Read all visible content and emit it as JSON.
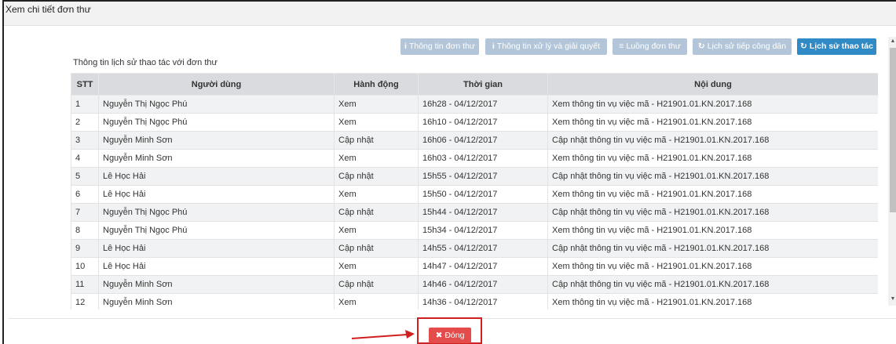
{
  "modal": {
    "title": "Xem chi tiết đơn thư"
  },
  "tabs": [
    {
      "icon": "i",
      "label": "Thông tin đơn thư"
    },
    {
      "icon": "i",
      "label": "Thông tin xử lý và giải quyết"
    },
    {
      "icon": "≡",
      "label": "Luồng đơn thư"
    },
    {
      "icon": "↻",
      "label": "Lịch sử tiếp công dân"
    },
    {
      "icon": "↻",
      "label": "Lịch sử thao tác"
    }
  ],
  "section": {
    "title": "Thông tin lịch sử thao tác với đơn thư"
  },
  "table": {
    "headers": [
      "STT",
      "Người dùng",
      "Hành động",
      "Thời gian",
      "Nội dung"
    ],
    "rows": [
      [
        "1",
        "Nguyễn Thị Ngọc Phú",
        "Xem",
        "16h28 - 04/12/2017",
        "Xem thông tin vụ việc mã - H21901.01.KN.2017.168"
      ],
      [
        "2",
        "Nguyễn Thị Ngọc Phú",
        "Xem",
        "16h10 - 04/12/2017",
        "Xem thông tin vụ việc mã - H21901.01.KN.2017.168"
      ],
      [
        "3",
        "Nguyễn Minh Sơn",
        "Cập nhật",
        "16h06 - 04/12/2017",
        "Cập nhật thông tin vụ việc mã - H21901.01.KN.2017.168"
      ],
      [
        "4",
        "Nguyễn Minh Sơn",
        "Xem",
        "16h03 - 04/12/2017",
        "Xem thông tin vụ việc mã - H21901.01.KN.2017.168"
      ],
      [
        "5",
        "Lê Học Hải",
        "Cập nhật",
        "15h55 - 04/12/2017",
        "Cập nhật thông tin vụ việc mã - H21901.01.KN.2017.168"
      ],
      [
        "6",
        "Lê Học Hải",
        "Xem",
        "15h50 - 04/12/2017",
        "Xem thông tin vụ việc mã - H21901.01.KN.2017.168"
      ],
      [
        "7",
        "Nguyễn Thị Ngọc Phú",
        "Cập nhật",
        "15h44 - 04/12/2017",
        "Cập nhật thông tin vụ việc mã - H21901.01.KN.2017.168"
      ],
      [
        "8",
        "Nguyễn Thị Ngọc Phú",
        "Xem",
        "15h34 - 04/12/2017",
        "Xem thông tin vụ việc mã - H21901.01.KN.2017.168"
      ],
      [
        "9",
        "Lê Học Hải",
        "Cập nhật",
        "14h55 - 04/12/2017",
        "Cập nhật thông tin vụ việc mã - H21901.01.KN.2017.168"
      ],
      [
        "10",
        "Lê Học Hải",
        "Xem",
        "14h47 - 04/12/2017",
        "Xem thông tin vụ việc mã - H21901.01.KN.2017.168"
      ],
      [
        "11",
        "Nguyễn Minh Sơn",
        "Cập nhật",
        "14h46 - 04/12/2017",
        "Cập nhật thông tin vụ việc mã - H21901.01.KN.2017.168"
      ],
      [
        "12",
        "Nguyễn Minh Sơn",
        "Xem",
        "14h36 - 04/12/2017",
        "Xem thông tin vụ việc mã - H21901.01.KN.2017.168"
      ]
    ]
  },
  "footer": {
    "close_icon": "✖",
    "close_label": "Đóng"
  },
  "colors": {
    "tab_inactive": "#b3c6d9",
    "tab_active": "#2f8ac6",
    "close_button": "#e44b4b",
    "highlight": "#d01f1f"
  }
}
